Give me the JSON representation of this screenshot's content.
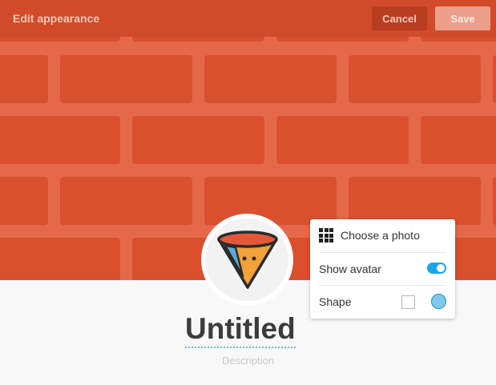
{
  "header": {
    "title": "Edit appearance",
    "cancel_label": "Cancel",
    "save_label": "Save"
  },
  "page": {
    "title": "Untitled",
    "description_placeholder": "Description"
  },
  "appearance_menu": {
    "choose_photo_label": "Choose a photo",
    "choose_photo_icon": "grid-icon",
    "show_avatar_label": "Show avatar",
    "show_avatar_enabled": true,
    "shape_label": "Shape",
    "shape_options": [
      "square",
      "circle"
    ],
    "shape_selected": "circle"
  },
  "colors": {
    "cover": "#e6684a",
    "brick": "#d9502e",
    "accent": "#1aa5e5"
  },
  "avatar": {
    "icon": "fox-avatar-icon"
  }
}
